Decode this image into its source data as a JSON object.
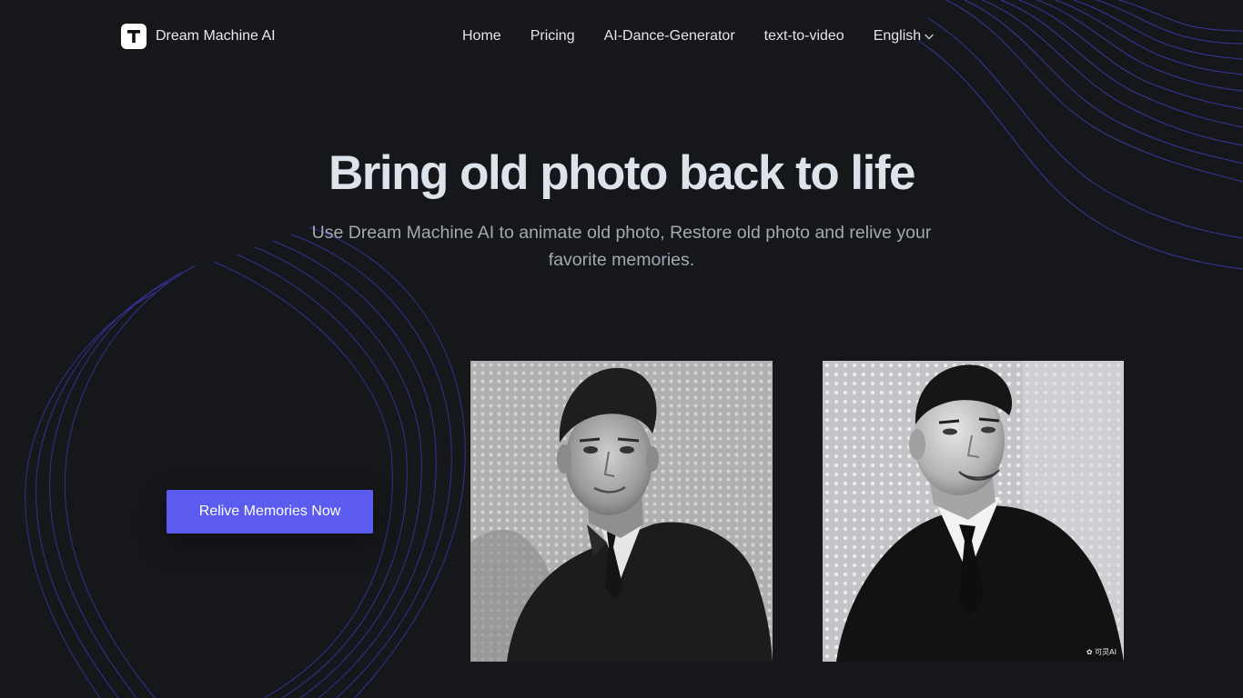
{
  "brand": {
    "name": "Dream Machine AI",
    "logo_letter": "T"
  },
  "nav": {
    "items": [
      {
        "label": "Home"
      },
      {
        "label": "Pricing"
      },
      {
        "label": "AI-Dance-Generator"
      },
      {
        "label": "text-to-video"
      }
    ],
    "language": {
      "label": "English",
      "icon": "chevron-down-icon"
    }
  },
  "hero": {
    "title": "Bring old photo back to life",
    "subtitle": "Use Dream Machine AI to animate old photo, Restore old photo and relive your favorite memories."
  },
  "cta": {
    "label": "Relive Memories Now"
  },
  "photos": {
    "after_watermark": "✿ 可灵AI"
  },
  "colors": {
    "background": "#16171a",
    "accent": "#5b5bf0",
    "lines": "#4b49c9"
  }
}
